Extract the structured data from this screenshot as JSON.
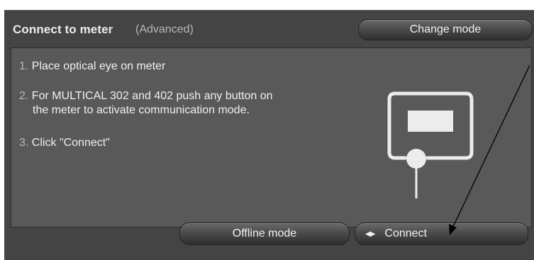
{
  "header": {
    "title": "Connect to meter",
    "subtitle": "(Advanced)",
    "change_mode_label": "Change mode"
  },
  "instructions": {
    "step1_num": "1.",
    "step1_text": "Place optical eye on meter",
    "step2_num": "2.",
    "step2_line1": "For MULTICAL 302 and 402 push any button on",
    "step2_line2": "the meter to activate communication mode.",
    "step3_num": "3.",
    "step3_text": "Click \"Connect\""
  },
  "footer": {
    "offline_label": "Offline mode",
    "connect_label": "Connect",
    "connect_icon": "connect-arrows-icon"
  },
  "colors": {
    "panel_bg": "#444444",
    "content_bg": "#595959",
    "text": "#f0f0f0",
    "muted_text": "#b8b8b8"
  },
  "graphic": {
    "icon": "meter-optical-eye-icon"
  }
}
